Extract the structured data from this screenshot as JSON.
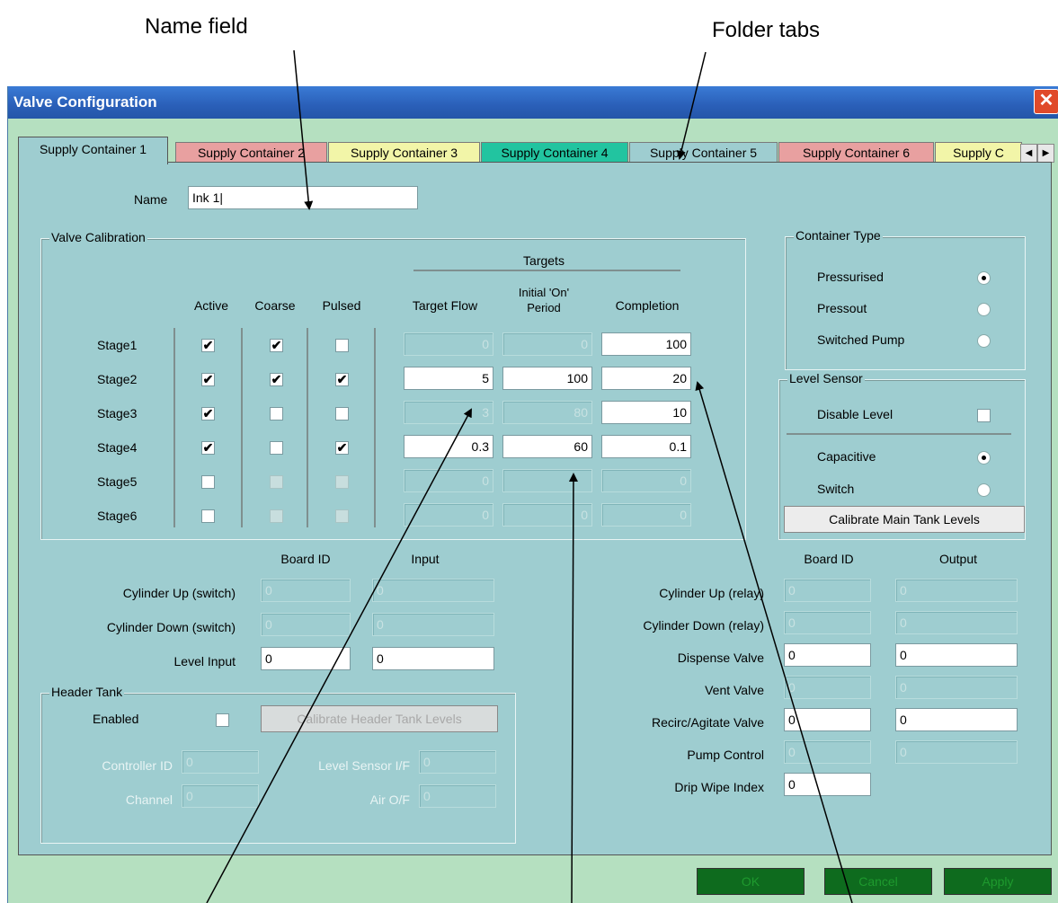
{
  "annotations": {
    "name_field": "Name field",
    "folder_tabs": "Folder tabs"
  },
  "window": {
    "title": "Valve Configuration",
    "close_glyph": "✕"
  },
  "tabs": [
    {
      "label": "Supply Container 1",
      "color": "#9ecdd0"
    },
    {
      "label": "Supply Container 2",
      "color": "#e8a0a0"
    },
    {
      "label": "Supply Container 3",
      "color": "#f2f5a8"
    },
    {
      "label": "Supply Container 4",
      "color": "#22c4a0"
    },
    {
      "label": "Supply Container 5",
      "color": "#9ecdd0"
    },
    {
      "label": "Supply Container 6",
      "color": "#e8a0a0"
    },
    {
      "label": "Supply C",
      "color": "#f2f5a8"
    }
  ],
  "tab_scroll": {
    "left": "◀",
    "right": "▶"
  },
  "name": {
    "label": "Name",
    "value": "Ink 1|"
  },
  "valve_calibration": {
    "title": "Valve Calibration",
    "targets_header": "Targets",
    "columns": {
      "active": "Active",
      "coarse": "Coarse",
      "pulsed": "Pulsed",
      "target_flow": "Target Flow",
      "initial_on_1": "Initial 'On'",
      "initial_on_2": "Period",
      "completion": "Completion"
    },
    "stages": [
      {
        "label": "Stage1",
        "active": true,
        "coarse": true,
        "pulsed": false,
        "target_flow": "0",
        "initial_on": "0",
        "completion": "100"
      },
      {
        "label": "Stage2",
        "active": true,
        "coarse": true,
        "pulsed": true,
        "target_flow": "5",
        "initial_on": "100",
        "completion": "20"
      },
      {
        "label": "Stage3",
        "active": true,
        "coarse": false,
        "pulsed": false,
        "target_flow": "3",
        "initial_on": "80",
        "completion": "10"
      },
      {
        "label": "Stage4",
        "active": true,
        "coarse": false,
        "pulsed": true,
        "target_flow": "0.3",
        "initial_on": "60",
        "completion": "0.1"
      },
      {
        "label": "Stage5",
        "active": false,
        "coarse": false,
        "pulsed": false,
        "target_flow": "0",
        "initial_on": "",
        "completion": "0"
      },
      {
        "label": "Stage6",
        "active": false,
        "coarse": false,
        "pulsed": false,
        "target_flow": "0",
        "initial_on": "0",
        "completion": "0"
      }
    ]
  },
  "container_type": {
    "title": "Container Type",
    "options": [
      {
        "label": "Pressurised",
        "selected": true
      },
      {
        "label": "Pressout",
        "selected": false
      },
      {
        "label": "Switched Pump",
        "selected": false
      }
    ]
  },
  "level_sensor": {
    "title": "Level Sensor",
    "disable_level": "Disable Level",
    "options": [
      {
        "label": "Capacitive",
        "selected": true
      },
      {
        "label": "Switch",
        "selected": false
      }
    ],
    "calibrate_button": "Calibrate Main Tank Levels"
  },
  "inputs": {
    "board_id_header": "Board ID",
    "input_header": "Input",
    "rows": [
      {
        "label": "Cylinder Up (switch)",
        "board_id": "0",
        "input": "0",
        "enabled": false
      },
      {
        "label": "Cylinder Down (switch)",
        "board_id": "0",
        "input": "0",
        "enabled": false
      },
      {
        "label": "Level Input",
        "board_id": "0",
        "input": "0",
        "enabled": true
      }
    ]
  },
  "outputs": {
    "board_id_header": "Board ID",
    "output_header": "Output",
    "rows": [
      {
        "label": "Cylinder Up (relay)",
        "board_id": "0",
        "output": "0",
        "enabled": false
      },
      {
        "label": "Cylinder Down (relay)",
        "board_id": "0",
        "output": "0",
        "enabled": false
      },
      {
        "label": "Dispense Valve",
        "board_id": "0",
        "output": "0",
        "enabled": true
      },
      {
        "label": "Vent Valve",
        "board_id": "0",
        "output": "0",
        "enabled": false
      },
      {
        "label": "Recirc/Agitate Valve",
        "board_id": "0",
        "output": "0",
        "enabled": true
      },
      {
        "label": "Pump Control",
        "board_id": "0",
        "output": "0",
        "enabled": false
      },
      {
        "label": "Drip Wipe Index",
        "board_id": "0",
        "enabled": true
      }
    ]
  },
  "header_tank": {
    "title": "Header Tank",
    "enabled_label": "Enabled",
    "calibrate_button": "Calibrate Header Tank Levels",
    "controller_id_label": "Controller ID",
    "controller_id": "0",
    "channel_label": "Channel",
    "channel": "0",
    "level_sensor_label": "Level Sensor I/F",
    "level_sensor": "0",
    "air_label": "Air O/F",
    "air": "0"
  },
  "buttons": {
    "ok": "OK",
    "cancel": "Cancel",
    "apply": "Apply"
  }
}
